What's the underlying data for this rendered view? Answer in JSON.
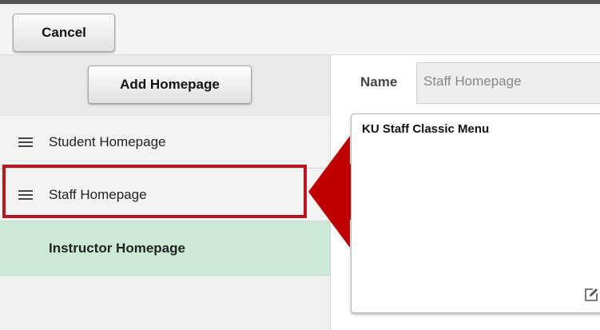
{
  "toolbar": {
    "cancel_label": "Cancel"
  },
  "sidebar": {
    "add_label": "Add Homepage",
    "items": [
      {
        "label": "Student Homepage",
        "icon": "drag-handle-icon"
      },
      {
        "label": "Staff Homepage",
        "icon": "drag-handle-icon",
        "highlighted": true
      },
      {
        "label": "Instructor Homepage",
        "selected": true
      }
    ]
  },
  "detail": {
    "name_label": "Name",
    "name_value": "Staff Homepage",
    "content_title": "KU Staff Classic Menu",
    "edit_icon": "edit-icon"
  },
  "colors": {
    "highlight": "#b7181d",
    "arrow": "#c00000",
    "selected_row": "#cce9d6"
  }
}
